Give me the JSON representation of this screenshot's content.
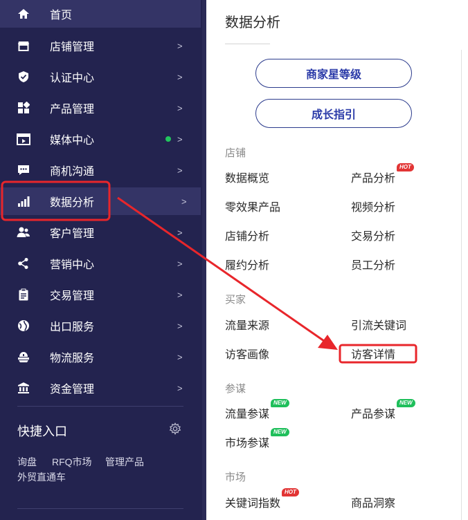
{
  "sidebar": {
    "items": [
      {
        "label": "首页",
        "icon": "home-icon"
      },
      {
        "label": "店铺管理",
        "icon": "store-icon",
        "chevron": ">"
      },
      {
        "label": "认证中心",
        "icon": "shield-icon",
        "chevron": ">"
      },
      {
        "label": "产品管理",
        "icon": "product-icon",
        "chevron": ">"
      },
      {
        "label": "媒体中心",
        "icon": "media-icon",
        "chevron": ">"
      },
      {
        "label": "商机沟通",
        "icon": "chat-icon",
        "chevron": ">"
      },
      {
        "label": "数据分析",
        "icon": "bar-chart-icon",
        "chevron": ">"
      },
      {
        "label": "客户管理",
        "icon": "customers-icon",
        "chevron": ">"
      },
      {
        "label": "营销中心",
        "icon": "marketing-icon",
        "chevron": ">"
      },
      {
        "label": "交易管理",
        "icon": "clipboard-icon",
        "chevron": ">"
      },
      {
        "label": "出口服务",
        "icon": "globe-icon",
        "chevron": ">"
      },
      {
        "label": "物流服务",
        "icon": "logistics-icon",
        "chevron": ">"
      },
      {
        "label": "资金管理",
        "icon": "bank-icon",
        "chevron": ">"
      }
    ],
    "quick_entry": {
      "title": "快捷入口",
      "links": [
        "询盘",
        "RFQ市场",
        "管理产品",
        "外贸直通车"
      ]
    }
  },
  "panel": {
    "title": "数据分析",
    "buttons": [
      "商家星等级",
      "成长指引"
    ],
    "sections": [
      {
        "heading": "店铺",
        "links": [
          {
            "label": "数据概览"
          },
          {
            "label": "产品分析",
            "badge": "HOT"
          },
          {
            "label": "零效果产品"
          },
          {
            "label": "视频分析"
          },
          {
            "label": "店铺分析"
          },
          {
            "label": "交易分析"
          },
          {
            "label": "履约分析"
          },
          {
            "label": "员工分析"
          }
        ]
      },
      {
        "heading": "买家",
        "links": [
          {
            "label": "流量来源"
          },
          {
            "label": "引流关键词"
          },
          {
            "label": "访客画像"
          },
          {
            "label": "访客详情"
          }
        ]
      },
      {
        "heading": "参谋",
        "links": [
          {
            "label": "流量参谋",
            "badge": "NEW"
          },
          {
            "label": "产品参谋",
            "badge": "NEW"
          },
          {
            "label": "市场参谋",
            "badge": "NEW"
          }
        ]
      },
      {
        "heading": "市场",
        "links": [
          {
            "label": "关键词指数",
            "badge": "HOT"
          },
          {
            "label": "商品洞察"
          }
        ]
      }
    ]
  },
  "colors": {
    "sidebar_bg": "#23234f",
    "sidebar_active": "#343466",
    "annotation_red": "#e8262b",
    "pill_text": "#2a3aa8",
    "online_dot": "#22c55e"
  }
}
